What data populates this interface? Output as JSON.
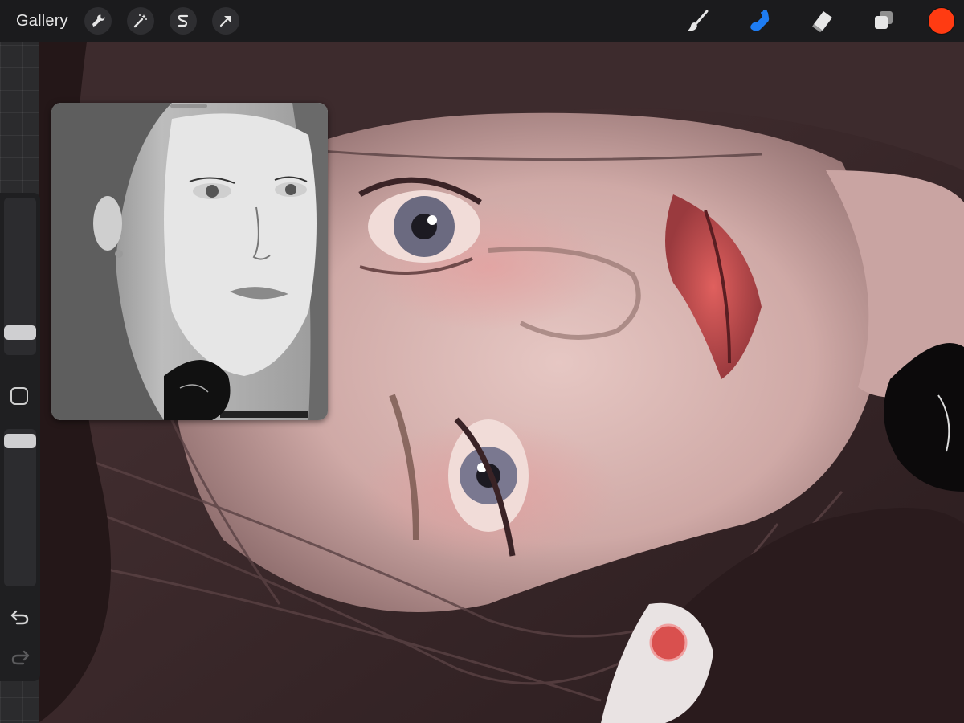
{
  "toolbar": {
    "gallery_label": "Gallery",
    "left_tools": [
      "wrench-icon",
      "magic-wand-icon",
      "selection-s-icon",
      "transform-arrow-icon"
    ],
    "right_tools": [
      "brush-icon",
      "smudge-icon",
      "eraser-icon",
      "layers-icon"
    ],
    "active_tool": "smudge-icon",
    "active_color": "#ff3b12",
    "accent_color": "#1e7cf2"
  },
  "sidebar": {
    "size_level": 0.19,
    "opacity_level": 0.03,
    "icons": [
      "modify-square-icon",
      "undo-icon",
      "redo-icon"
    ]
  }
}
